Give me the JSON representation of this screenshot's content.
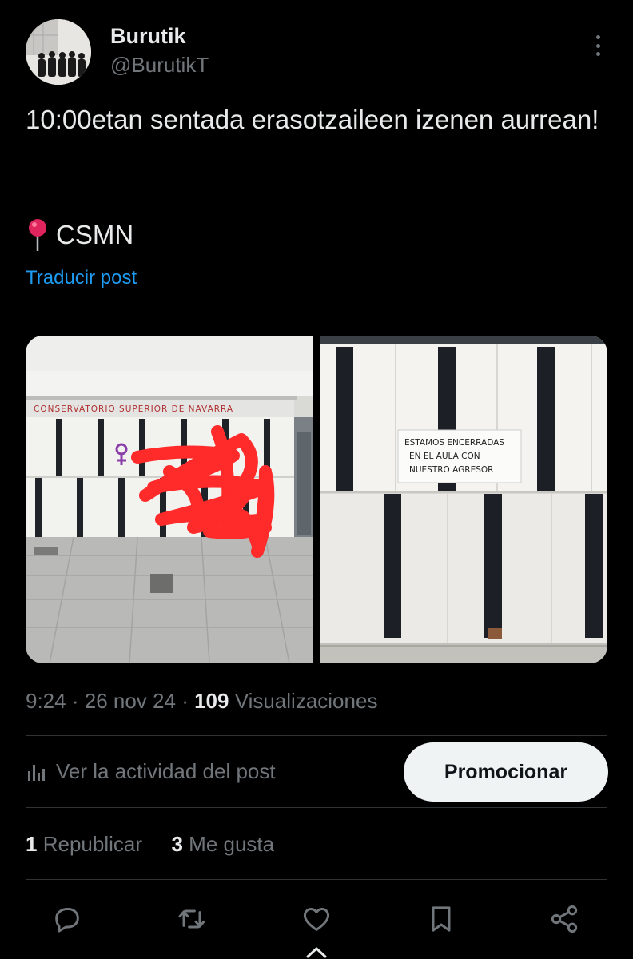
{
  "author": {
    "name": "Burutik",
    "handle": "@BurutikT"
  },
  "post": {
    "text": "10:00etan sentada erasotzaileen izenen aurrean!",
    "location_label": "CSMN",
    "translate_label": "Traducir post"
  },
  "media": {
    "image1_sign": "CONSERVATORIO SUPERIOR      DE NAVARRA",
    "image2_sign_lines": [
      "ESTAMOS ENCERRADAS",
      "EN EL AULA CON",
      "NUESTRO AGRESOR"
    ]
  },
  "meta": {
    "time": "9:24",
    "date": "26 nov 24",
    "views_count": "109",
    "views_label": "Visualizaciones"
  },
  "activity": {
    "label": "Ver la actividad del post",
    "promote_label": "Promocionar"
  },
  "stats": {
    "reposts_count": "1",
    "reposts_label": "Republicar",
    "likes_count": "3",
    "likes_label": "Me gusta"
  },
  "icons": [
    "more-vertical-icon",
    "pin-icon",
    "bar-chart-icon",
    "reply-icon",
    "repost-icon",
    "like-icon",
    "bookmark-icon",
    "share-icon",
    "chevron-up-icon"
  ],
  "colors": {
    "background": "#000000",
    "text": "#e7e9ea",
    "secondary": "#71767b",
    "link": "#1d9bf0",
    "scribble": "#ff2a2a"
  }
}
